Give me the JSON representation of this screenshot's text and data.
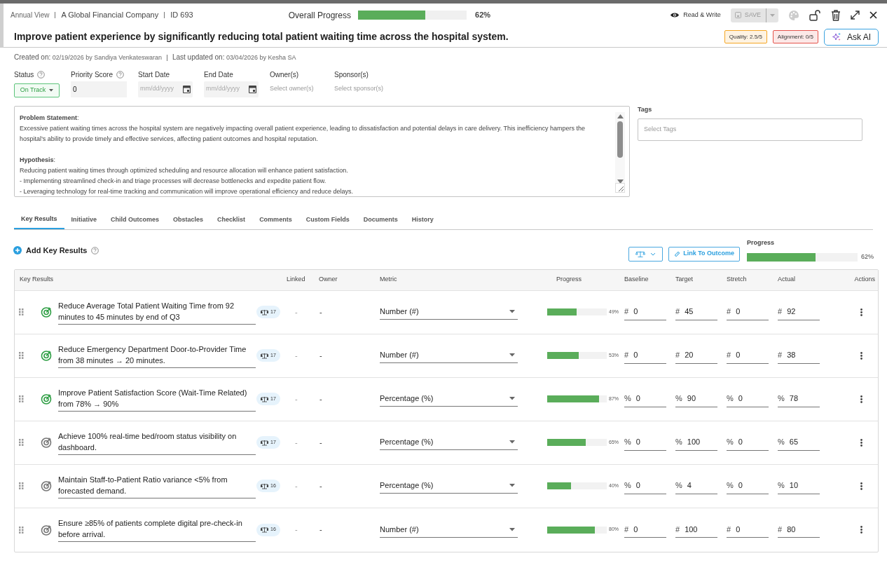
{
  "header": {
    "view": "Annual View",
    "company": "A Global Financial Company",
    "id": "ID 693",
    "progress_label": "Overall Progress",
    "progress": {
      "level": 0.62
    },
    "progress_text": "62%",
    "access": "Read & Write",
    "save": {
      "label": "SAVE",
      "disabled": true
    }
  },
  "title": "Improve patient experience by significantly reducing total patient waiting time across the hospital system.",
  "badges": [
    {
      "text": "Quality: 2.5/5",
      "color": "#f5a623"
    },
    {
      "text": "Alignment: 0/5",
      "color": "#e5534b"
    }
  ],
  "ask_ai": "Ask AI",
  "meta": {
    "created_label": "Created on:",
    "created": "02/19/2026 by Sandiya Venkateswaran",
    "updated_label": "Last updated on:",
    "updated": "03/04/2026 by Kesha SA"
  },
  "fields": [
    {
      "label": "Status",
      "help": true,
      "kind": "status",
      "value": "On Track"
    },
    {
      "label": "Priority Score",
      "help": true,
      "kind": "input",
      "value": "0"
    },
    {
      "label": "Start Date",
      "help": false,
      "kind": "date",
      "placeholder": "mm/dd/yyyy"
    },
    {
      "label": "End Date",
      "help": false,
      "kind": "date",
      "placeholder": "mm/dd/yyyy"
    },
    {
      "label": "Owner(s)",
      "help": false,
      "kind": "select",
      "placeholder": "Select owner(s)"
    },
    {
      "label": "Sponsor(s)",
      "help": false,
      "kind": "select",
      "placeholder": "Select sponsor(s)"
    }
  ],
  "description": [
    {
      "heading": "**Problem Statement**:",
      "lines": [
        "Excessive patient waiting times across the hospital system are negatively impacting overall patient experience, leading to dissatisfaction and potential delays in care delivery. This inefficiency hampers the hospital’s ability to provide timely and effective services, affecting patient outcomes and hospital reputation."
      ]
    },
    {
      "heading": "**Hypothesis**:",
      "lines": [
        "Reducing patient waiting times through optimized scheduling and resource allocation will enhance patient satisfaction.",
        "- Implementing streamlined check-in and triage processes will decrease bottlenecks and expedite patient flow.",
        "- Leveraging technology for real-time tracking and communication will improve operational efficiency and reduce delays."
      ]
    }
  ],
  "tags": {
    "label": "Tags",
    "placeholder": "Select Tags"
  },
  "tabs": [
    {
      "label": "Key Results",
      "selected": true
    },
    {
      "label": "Initiative",
      "selected": false
    },
    {
      "label": "Child Outcomes",
      "selected": false
    },
    {
      "label": "Obstacles",
      "selected": false
    },
    {
      "label": "Checklist",
      "selected": false
    },
    {
      "label": "Comments",
      "selected": false
    },
    {
      "label": "Custom Fields",
      "selected": false
    },
    {
      "label": "Documents",
      "selected": false
    },
    {
      "label": "History",
      "selected": false
    }
  ],
  "add_key_results": "Add Key Results",
  "link_button": "Link To Outcome",
  "progress": {
    "label": "Progress",
    "level": 0.62,
    "text": "62%"
  },
  "table": {
    "columns": [
      "Key Results",
      "Linked",
      "Owner",
      "Metric",
      "Progress",
      "Baseline",
      "Target",
      "Stretch",
      "Actual",
      "Actions"
    ],
    "rows": [
      {
        "title": "Reduce Average Total Patient Waiting Time from 92 minutes to  45 minutes by end of Q3",
        "color": "#2e9e44",
        "count": "17",
        "linked": "-",
        "owner": "-",
        "metric": "Number (#)",
        "level": 0.49,
        "percent": "49%",
        "baseline": {
          "unit": "#",
          "value": "0"
        },
        "target": {
          "unit": "#",
          "value": "45"
        },
        "stretch": {
          "unit": "#",
          "value": "0"
        },
        "actual": {
          "unit": "#",
          "value": "92"
        }
      },
      {
        "title": "Reduce Emergency Department Door-to-Provider Time from 38 minutes → 20 minutes.",
        "color": "#2e9e44",
        "count": "17",
        "linked": "-",
        "owner": "-",
        "metric": "Number (#)",
        "level": 0.53,
        "percent": "53%",
        "baseline": {
          "unit": "#",
          "value": "0"
        },
        "target": {
          "unit": "#",
          "value": "20"
        },
        "stretch": {
          "unit": "#",
          "value": "0"
        },
        "actual": {
          "unit": "#",
          "value": "38"
        }
      },
      {
        "title": "Improve Patient Satisfaction Score (Wait-Time Related) from 78% → 90%",
        "color": "#2e9e44",
        "count": "17",
        "linked": "-",
        "owner": "-",
        "metric": "Percentage (%)",
        "level": 0.87,
        "percent": "87%",
        "baseline": {
          "unit": "%",
          "value": "0"
        },
        "target": {
          "unit": "%",
          "value": "90"
        },
        "stretch": {
          "unit": "%",
          "value": "0"
        },
        "actual": {
          "unit": "%",
          "value": "78"
        }
      },
      {
        "title": "Achieve 100% real-time bed/room status visibility on dashboard.",
        "color": "#777777",
        "count": "17",
        "linked": "-",
        "owner": "-",
        "metric": "Percentage (%)",
        "level": 0.65,
        "percent": "65%",
        "baseline": {
          "unit": "%",
          "value": "0"
        },
        "target": {
          "unit": "%",
          "value": "100"
        },
        "stretch": {
          "unit": "%",
          "value": "0"
        },
        "actual": {
          "unit": "%",
          "value": "65"
        }
      },
      {
        "title": "Maintain Staff-to-Patient Ratio variance <5% from forecasted demand.",
        "color": "#777777",
        "count": "16",
        "linked": "-",
        "owner": "-",
        "metric": "Percentage (%)",
        "level": 0.4,
        "percent": "40%",
        "baseline": {
          "unit": "%",
          "value": "0"
        },
        "target": {
          "unit": "%",
          "value": "4"
        },
        "stretch": {
          "unit": "%",
          "value": "0"
        },
        "actual": {
          "unit": "%",
          "value": "10"
        }
      },
      {
        "title": "Ensure ≥85% of patients complete digital pre-check-in before arrival.",
        "color": "#777777",
        "count": "16",
        "linked": "-",
        "owner": "-",
        "metric": "Number (#)",
        "level": 0.8,
        "percent": "80%",
        "baseline": {
          "unit": "#",
          "value": "0"
        },
        "target": {
          "unit": "#",
          "value": "100"
        },
        "stretch": {
          "unit": "#",
          "value": "0"
        },
        "actual": {
          "unit": "#",
          "value": "80"
        }
      }
    ]
  }
}
